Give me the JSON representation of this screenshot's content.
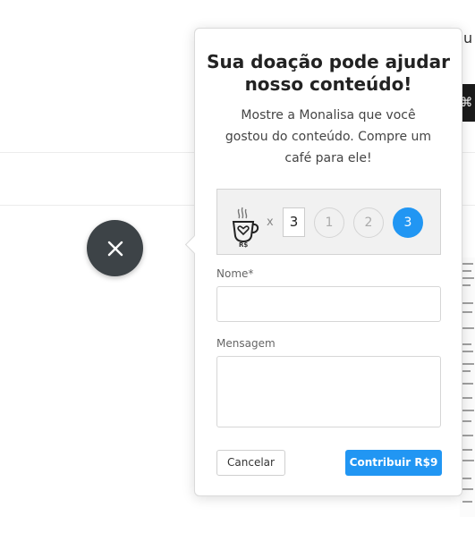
{
  "background": {
    "right_edge_text": "u",
    "dark_tab_glyph": "⌘"
  },
  "popup": {
    "title": "Sua doação pode ajudar nosso conteúdo!",
    "description": "Mostre a Monalisa que você gostou do conteúdo. Compre um café para ele!",
    "currency_label": "R$",
    "times_symbol": "x",
    "quantity_value": "3",
    "quantity_options": [
      "1",
      "2",
      "3"
    ],
    "selected_option": "3",
    "name_label": "Nome*",
    "message_label": "Mensagem",
    "cancel_label": "Cancelar",
    "contribute_label": "Contribuir R$9"
  },
  "colors": {
    "accent": "#2196f3",
    "close_button": "#3d4347"
  },
  "icons": {
    "close": "close-icon",
    "cup": "coffee-cup-heart-icon"
  }
}
